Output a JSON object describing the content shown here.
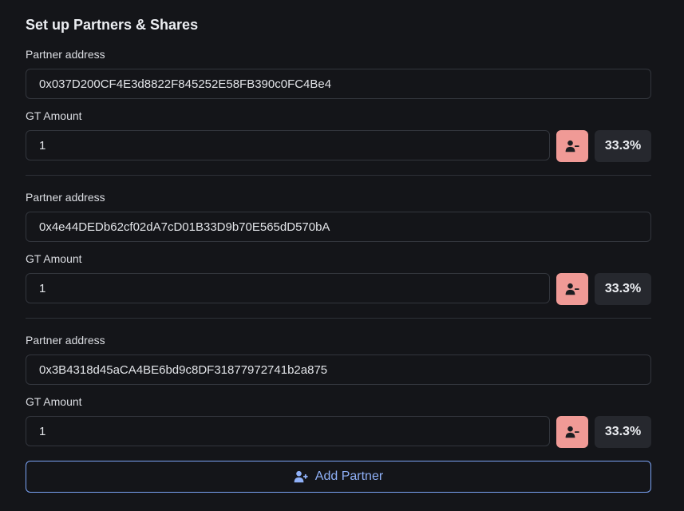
{
  "page": {
    "title": "Set up Partners & Shares"
  },
  "partners": [
    {
      "address_label": "Partner address",
      "address": "0x037D200CF4E3d8822F845252E58FB390c0FC4Be4",
      "amount_label": "GT Amount",
      "amount": "1",
      "share": "33.3%"
    },
    {
      "address_label": "Partner address",
      "address": "0x4e44DEDb62cf02dA7cD01B33D9b70E565dD570bA",
      "amount_label": "GT Amount",
      "amount": "1",
      "share": "33.3%"
    },
    {
      "address_label": "Partner address",
      "address": "0x3B4318d45aCA4BE6bd9c8DF31877972741b2a875",
      "amount_label": "GT Amount",
      "amount": "1",
      "share": "33.3%"
    }
  ],
  "actions": {
    "add_partner_label": "Add Partner"
  },
  "icons": {
    "remove": "user-minus-icon",
    "add": "user-plus-icon"
  },
  "colors": {
    "background": "#141519",
    "remove_button": "#f09a96",
    "accent": "#7aa3f5",
    "share_badge": "#26282e"
  }
}
